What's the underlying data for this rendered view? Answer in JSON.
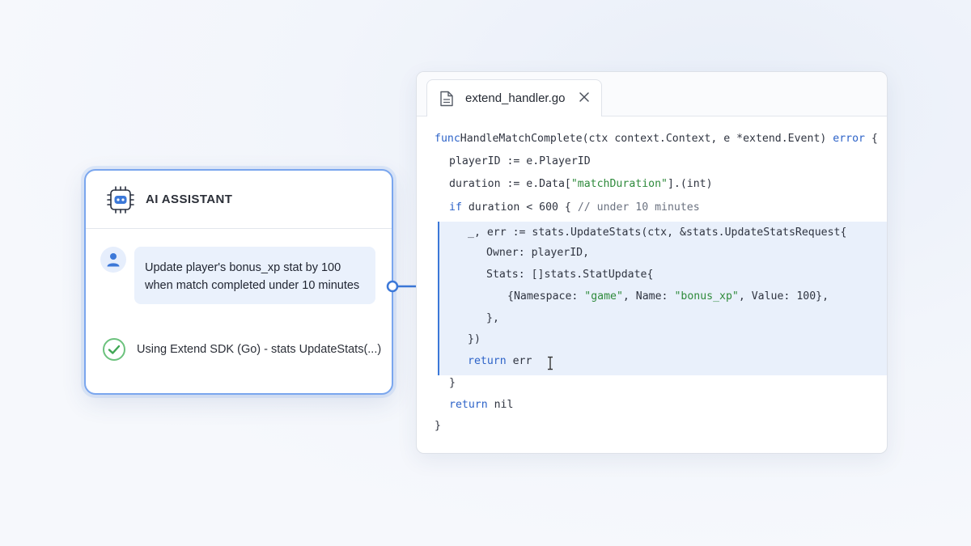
{
  "assistant": {
    "title": "AI ASSISTANT",
    "message": "Update player's bonus_xp stat by 100 when match completed under 10 minutes",
    "status": "Using Extend SDK (Go) - stats UpdateStats(...)"
  },
  "editor": {
    "tab_name": "extend_handler.go",
    "code_lines": [
      {
        "indent": 0,
        "parts": [
          [
            "kw",
            "func"
          ],
          [
            "",
            "HandleMatchComplete(ctx context.Context, e *extend.Event) "
          ],
          [
            "kw",
            "error"
          ],
          [
            "",
            " {"
          ]
        ]
      },
      {
        "indent": 1,
        "parts": [
          [
            "",
            "playerID := e.PlayerID"
          ]
        ]
      },
      {
        "indent": 1,
        "parts": [
          [
            "",
            "duration := e.Data["
          ],
          [
            "str",
            "\"matchDuration\""
          ],
          [
            "",
            "].(int)"
          ]
        ]
      },
      {
        "indent": 1,
        "parts": [
          [
            "kw",
            "if"
          ],
          [
            "",
            " duration < 600 { "
          ],
          [
            "cm",
            "// under 10 minutes"
          ]
        ]
      },
      {
        "indent": 2,
        "parts": [
          [
            "",
            "_, err := stats.UpdateStats(ctx, &stats.UpdateStatsRequest{"
          ]
        ]
      },
      {
        "indent": 3,
        "parts": [
          [
            "",
            "Owner: playerID,"
          ]
        ]
      },
      {
        "indent": 3,
        "parts": [
          [
            "",
            "Stats: []stats.StatUpdate{"
          ]
        ]
      },
      {
        "indent": 4,
        "parts": [
          [
            "",
            "{Namespace: "
          ],
          [
            "str",
            "\"game\""
          ],
          [
            "",
            ", Name: "
          ],
          [
            "str",
            "\"bonus_xp\""
          ],
          [
            "",
            ", Value: 100},"
          ]
        ]
      },
      {
        "indent": 3,
        "parts": [
          [
            "",
            "},"
          ]
        ]
      },
      {
        "indent": 2,
        "parts": [
          [
            "",
            "})"
          ]
        ]
      },
      {
        "indent": 2,
        "parts": [
          [
            "kw",
            "return"
          ],
          [
            "",
            " err"
          ]
        ]
      },
      {
        "indent": 1,
        "parts": [
          [
            "",
            "}"
          ]
        ]
      },
      {
        "indent": 1,
        "parts": [
          [
            "kw",
            "return"
          ],
          [
            "",
            " nil"
          ]
        ]
      },
      {
        "indent": 0,
        "parts": [
          [
            "",
            "}"
          ]
        ]
      }
    ]
  },
  "colors": {
    "accent": "#3c78d8",
    "keyword": "#2d63c8",
    "string": "#2e8a3b",
    "highlight_bg": "#e9f0fb"
  }
}
